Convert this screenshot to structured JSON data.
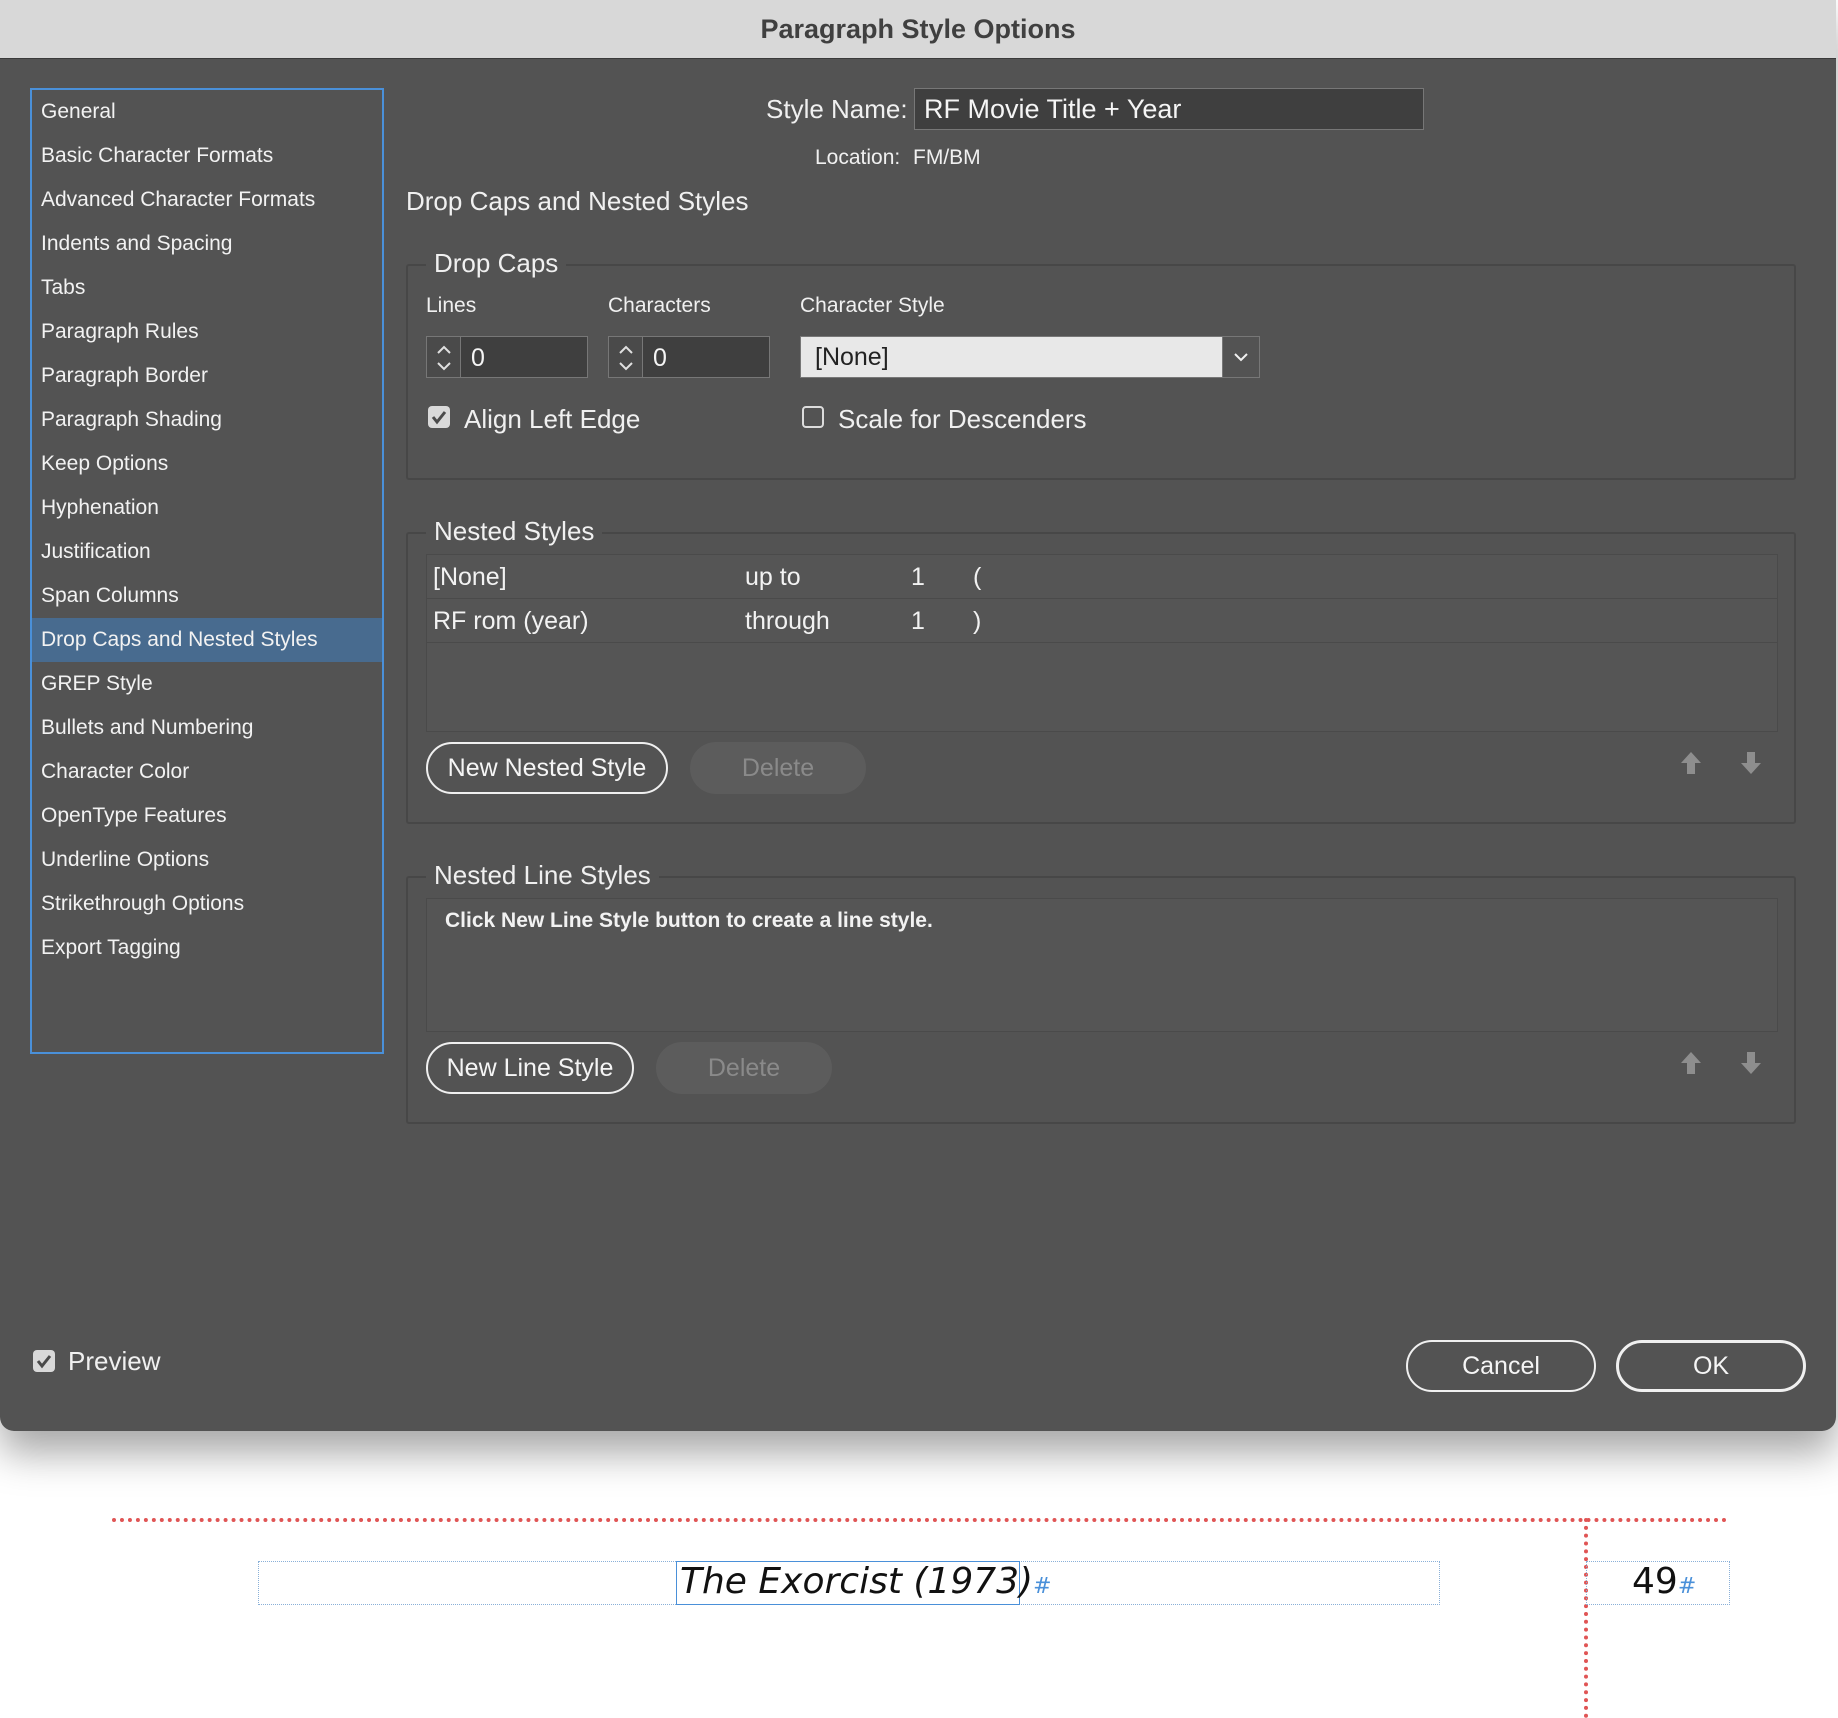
{
  "window": {
    "title": "Paragraph Style Options"
  },
  "sidebar": {
    "items": [
      {
        "label": "General"
      },
      {
        "label": "Basic Character Formats"
      },
      {
        "label": "Advanced Character Formats"
      },
      {
        "label": "Indents and Spacing"
      },
      {
        "label": "Tabs"
      },
      {
        "label": "Paragraph Rules"
      },
      {
        "label": "Paragraph Border"
      },
      {
        "label": "Paragraph Shading"
      },
      {
        "label": "Keep Options"
      },
      {
        "label": "Hyphenation"
      },
      {
        "label": "Justification"
      },
      {
        "label": "Span Columns"
      },
      {
        "label": "Drop Caps and Nested Styles",
        "selected": true
      },
      {
        "label": "GREP Style"
      },
      {
        "label": "Bullets and Numbering"
      },
      {
        "label": "Character Color"
      },
      {
        "label": "OpenType Features"
      },
      {
        "label": "Underline Options"
      },
      {
        "label": "Strikethrough Options"
      },
      {
        "label": "Export Tagging"
      }
    ]
  },
  "header": {
    "style_name_label": "Style Name:",
    "style_name_value": "RF Movie Title + Year",
    "location_label": "Location:",
    "location_value": "FM/BM",
    "section_title": "Drop Caps and Nested Styles"
  },
  "drop_caps": {
    "title": "Drop Caps",
    "lines_label": "Lines",
    "lines_value": "0",
    "characters_label": "Characters",
    "characters_value": "0",
    "char_style_label": "Character Style",
    "char_style_value": "[None]",
    "align_left_edge": {
      "label": "Align Left Edge",
      "checked": true
    },
    "scale_descenders": {
      "label": "Scale for Descenders",
      "checked": false
    }
  },
  "nested_styles": {
    "title": "Nested Styles",
    "rows": [
      {
        "style": "[None]",
        "mode": "up to",
        "count": "1",
        "char": "("
      },
      {
        "style": "RF rom (year)",
        "mode": "through",
        "count": "1",
        "char": ")"
      }
    ],
    "new_button": "New Nested Style",
    "delete_button": "Delete"
  },
  "nested_line_styles": {
    "title": "Nested Line Styles",
    "placeholder": "Click New Line Style button to create a line style.",
    "new_button": "New Line Style",
    "delete_button": "Delete"
  },
  "footer": {
    "preview": {
      "label": "Preview",
      "checked": true
    },
    "cancel": "Cancel",
    "ok": "OK"
  },
  "document_page": {
    "running_title": "The Exorcist (1973)",
    "page_number": "49",
    "pilcrow": "#"
  },
  "colors": {
    "dialog_bg": "#535353",
    "selection": "#486b8f",
    "focus_ring": "#4a90d9",
    "guide_red": "#e05555"
  }
}
